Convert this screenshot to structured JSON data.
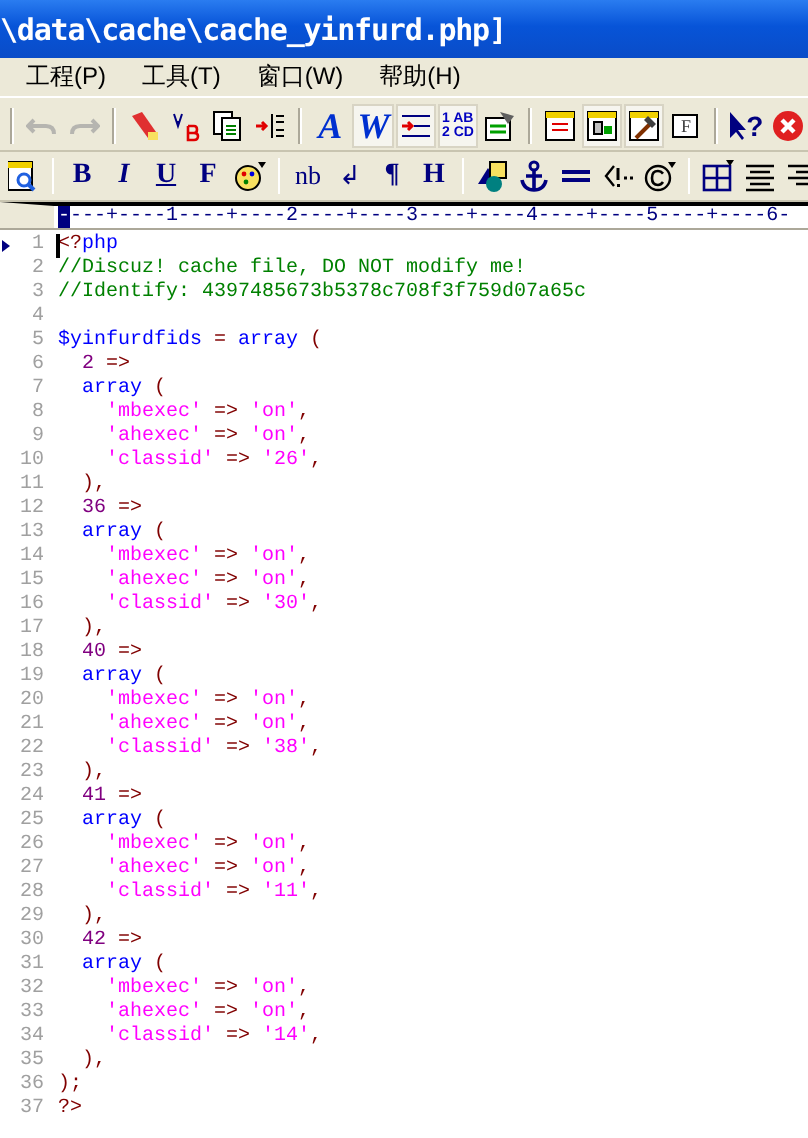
{
  "window": {
    "title": "\\data\\cache\\cache_yinfurd.php]"
  },
  "menu": [
    {
      "label": "工程(P)"
    },
    {
      "label": "工具(T)"
    },
    {
      "label": "窗口(W)"
    },
    {
      "label": "帮助(H)"
    }
  ],
  "toolbar": [
    {
      "kind": "sep"
    },
    {
      "kind": "undo",
      "disabled": true
    },
    {
      "kind": "redo",
      "disabled": true
    },
    {
      "kind": "sep"
    },
    {
      "kind": "flashlight",
      "pressed": false
    },
    {
      "kind": "replace",
      "pressed": false
    },
    {
      "kind": "copies",
      "pressed": false
    },
    {
      "kind": "indent-list",
      "pressed": false
    },
    {
      "kind": "sep"
    },
    {
      "kind": "letter",
      "label": "A",
      "pressed": false
    },
    {
      "kind": "letter",
      "label": "W",
      "pressed": true
    },
    {
      "kind": "indent",
      "pressed": true
    },
    {
      "kind": "numbered",
      "label": "1 AB",
      "label2": "2 CD",
      "pressed": true
    },
    {
      "kind": "certificate",
      "pressed": false
    },
    {
      "kind": "sep"
    },
    {
      "kind": "window-list",
      "pressed": false
    },
    {
      "kind": "window-panel",
      "pressed": true
    },
    {
      "kind": "hammer",
      "pressed": true
    },
    {
      "kind": "window-f",
      "label": "F",
      "pressed": false
    },
    {
      "kind": "sep"
    },
    {
      "kind": "help",
      "label": "?",
      "pressed": false
    },
    {
      "kind": "close",
      "pressed": false
    }
  ],
  "format_toolbar": [
    {
      "kind": "preview"
    },
    {
      "kind": "sep"
    },
    {
      "kind": "bold",
      "label": "B"
    },
    {
      "kind": "italic",
      "label": "I"
    },
    {
      "kind": "underline",
      "label": "U"
    },
    {
      "kind": "bold",
      "label": "F"
    },
    {
      "kind": "palette"
    },
    {
      "kind": "sep"
    },
    {
      "kind": "plain",
      "label": "nb"
    },
    {
      "kind": "plain",
      "label": "↲"
    },
    {
      "kind": "bold",
      "label": "¶"
    },
    {
      "kind": "bold",
      "label": "H"
    },
    {
      "kind": "sep"
    },
    {
      "kind": "shapes"
    },
    {
      "kind": "anchor"
    },
    {
      "kind": "rule"
    },
    {
      "kind": "comment"
    },
    {
      "kind": "copyright"
    },
    {
      "kind": "sep"
    },
    {
      "kind": "table"
    },
    {
      "kind": "align-center"
    },
    {
      "kind": "align-right"
    }
  ],
  "ruler": {
    "text": "----+----1----+----2----+----3----+----4----+----5----+----6-"
  },
  "editor": {
    "lines": [
      {
        "number": "1",
        "marked": true,
        "tokens": [
          {
            "kind": "punct",
            "text": "<?"
          },
          {
            "kind": "keyword",
            "text": "php"
          }
        ]
      },
      {
        "number": "2",
        "marked": false,
        "tokens": [
          {
            "kind": "comment",
            "text": "//Discuz! cache file, DO NOT modify me!"
          }
        ]
      },
      {
        "number": "3",
        "marked": false,
        "tokens": [
          {
            "kind": "comment",
            "text": "//Identify: 4397485673b5378c708f3f759d07a65c"
          }
        ]
      },
      {
        "number": "4",
        "marked": false
      },
      {
        "number": "5",
        "marked": false,
        "tokens": [
          {
            "kind": "variable",
            "text": "$yinfurdfids"
          },
          {
            "kind": "punct",
            "text": " = "
          },
          {
            "kind": "keyword",
            "text": "array"
          },
          {
            "kind": "punct",
            "text": " ("
          }
        ]
      },
      {
        "number": "6",
        "marked": false,
        "tokens": [
          {
            "kind": "number",
            "text": "  2"
          },
          {
            "kind": "punct",
            "text": " =>"
          }
        ]
      },
      {
        "number": "7",
        "marked": false,
        "tokens": [
          {
            "kind": "keyword",
            "text": "  array"
          },
          {
            "kind": "punct",
            "text": " ("
          }
        ]
      },
      {
        "number": "8",
        "marked": false,
        "tokens": [
          {
            "kind": "string",
            "text": "    'mbexec'"
          },
          {
            "kind": "punct",
            "text": " => "
          },
          {
            "kind": "string",
            "text": "'on'"
          },
          {
            "kind": "punct",
            "text": ","
          }
        ]
      },
      {
        "number": "9",
        "marked": false,
        "tokens": [
          {
            "kind": "string",
            "text": "    'ahexec'"
          },
          {
            "kind": "punct",
            "text": " => "
          },
          {
            "kind": "string",
            "text": "'on'"
          },
          {
            "kind": "punct",
            "text": ","
          }
        ]
      },
      {
        "number": "10",
        "marked": false,
        "tokens": [
          {
            "kind": "string",
            "text": "    'classid'"
          },
          {
            "kind": "punct",
            "text": " => "
          },
          {
            "kind": "string",
            "text": "'26'"
          },
          {
            "kind": "punct",
            "text": ","
          }
        ]
      },
      {
        "number": "11",
        "marked": false,
        "tokens": [
          {
            "kind": "punct",
            "text": "  ),"
          }
        ]
      },
      {
        "number": "12",
        "marked": false,
        "tokens": [
          {
            "kind": "number",
            "text": "  36"
          },
          {
            "kind": "punct",
            "text": " =>"
          }
        ]
      },
      {
        "number": "13",
        "marked": false,
        "tokens": [
          {
            "kind": "keyword",
            "text": "  array"
          },
          {
            "kind": "punct",
            "text": " ("
          }
        ]
      },
      {
        "number": "14",
        "marked": false,
        "tokens": [
          {
            "kind": "string",
            "text": "    'mbexec'"
          },
          {
            "kind": "punct",
            "text": " => "
          },
          {
            "kind": "string",
            "text": "'on'"
          },
          {
            "kind": "punct",
            "text": ","
          }
        ]
      },
      {
        "number": "15",
        "marked": false,
        "tokens": [
          {
            "kind": "string",
            "text": "    'ahexec'"
          },
          {
            "kind": "punct",
            "text": " => "
          },
          {
            "kind": "string",
            "text": "'on'"
          },
          {
            "kind": "punct",
            "text": ","
          }
        ]
      },
      {
        "number": "16",
        "marked": false,
        "tokens": [
          {
            "kind": "string",
            "text": "    'classid'"
          },
          {
            "kind": "punct",
            "text": " => "
          },
          {
            "kind": "string",
            "text": "'30'"
          },
          {
            "kind": "punct",
            "text": ","
          }
        ]
      },
      {
        "number": "17",
        "marked": false,
        "tokens": [
          {
            "kind": "punct",
            "text": "  ),"
          }
        ]
      },
      {
        "number": "18",
        "marked": false,
        "tokens": [
          {
            "kind": "number",
            "text": "  40"
          },
          {
            "kind": "punct",
            "text": " =>"
          }
        ]
      },
      {
        "number": "19",
        "marked": false,
        "tokens": [
          {
            "kind": "keyword",
            "text": "  array"
          },
          {
            "kind": "punct",
            "text": " ("
          }
        ]
      },
      {
        "number": "20",
        "marked": false,
        "tokens": [
          {
            "kind": "string",
            "text": "    'mbexec'"
          },
          {
            "kind": "punct",
            "text": " => "
          },
          {
            "kind": "string",
            "text": "'on'"
          },
          {
            "kind": "punct",
            "text": ","
          }
        ]
      },
      {
        "number": "21",
        "marked": false,
        "tokens": [
          {
            "kind": "string",
            "text": "    'ahexec'"
          },
          {
            "kind": "punct",
            "text": " => "
          },
          {
            "kind": "string",
            "text": "'on'"
          },
          {
            "kind": "punct",
            "text": ","
          }
        ]
      },
      {
        "number": "22",
        "marked": false,
        "tokens": [
          {
            "kind": "string",
            "text": "    'classid'"
          },
          {
            "kind": "punct",
            "text": " => "
          },
          {
            "kind": "string",
            "text": "'38'"
          },
          {
            "kind": "punct",
            "text": ","
          }
        ]
      },
      {
        "number": "23",
        "marked": false,
        "tokens": [
          {
            "kind": "punct",
            "text": "  ),"
          }
        ]
      },
      {
        "number": "24",
        "marked": false,
        "tokens": [
          {
            "kind": "number",
            "text": "  41"
          },
          {
            "kind": "punct",
            "text": " =>"
          }
        ]
      },
      {
        "number": "25",
        "marked": false,
        "tokens": [
          {
            "kind": "keyword",
            "text": "  array"
          },
          {
            "kind": "punct",
            "text": " ("
          }
        ]
      },
      {
        "number": "26",
        "marked": false,
        "tokens": [
          {
            "kind": "string",
            "text": "    'mbexec'"
          },
          {
            "kind": "punct",
            "text": " => "
          },
          {
            "kind": "string",
            "text": "'on'"
          },
          {
            "kind": "punct",
            "text": ","
          }
        ]
      },
      {
        "number": "27",
        "marked": false,
        "tokens": [
          {
            "kind": "string",
            "text": "    'ahexec'"
          },
          {
            "kind": "punct",
            "text": " => "
          },
          {
            "kind": "string",
            "text": "'on'"
          },
          {
            "kind": "punct",
            "text": ","
          }
        ]
      },
      {
        "number": "28",
        "marked": false,
        "tokens": [
          {
            "kind": "string",
            "text": "    'classid'"
          },
          {
            "kind": "punct",
            "text": " => "
          },
          {
            "kind": "string",
            "text": "'11'"
          },
          {
            "kind": "punct",
            "text": ","
          }
        ]
      },
      {
        "number": "29",
        "marked": false,
        "tokens": [
          {
            "kind": "punct",
            "text": "  ),"
          }
        ]
      },
      {
        "number": "30",
        "marked": false,
        "tokens": [
          {
            "kind": "number",
            "text": "  42"
          },
          {
            "kind": "punct",
            "text": " =>"
          }
        ]
      },
      {
        "number": "31",
        "marked": false,
        "tokens": [
          {
            "kind": "keyword",
            "text": "  array"
          },
          {
            "kind": "punct",
            "text": " ("
          }
        ]
      },
      {
        "number": "32",
        "marked": false,
        "tokens": [
          {
            "kind": "string",
            "text": "    'mbexec'"
          },
          {
            "kind": "punct",
            "text": " => "
          },
          {
            "kind": "string",
            "text": "'on'"
          },
          {
            "kind": "punct",
            "text": ","
          }
        ]
      },
      {
        "number": "33",
        "marked": false,
        "tokens": [
          {
            "kind": "string",
            "text": "    'ahexec'"
          },
          {
            "kind": "punct",
            "text": " => "
          },
          {
            "kind": "string",
            "text": "'on'"
          },
          {
            "kind": "punct",
            "text": ","
          }
        ]
      },
      {
        "number": "34",
        "marked": false,
        "tokens": [
          {
            "kind": "string",
            "text": "    'classid'"
          },
          {
            "kind": "punct",
            "text": " => "
          },
          {
            "kind": "string",
            "text": "'14'"
          },
          {
            "kind": "punct",
            "text": ","
          }
        ]
      },
      {
        "number": "35",
        "marked": false,
        "tokens": [
          {
            "kind": "punct",
            "text": "  ),"
          }
        ]
      },
      {
        "number": "36",
        "marked": false,
        "tokens": [
          {
            "kind": "punct",
            "text": ");"
          }
        ]
      },
      {
        "number": "37",
        "marked": false,
        "tokens": [
          {
            "kind": "punct",
            "text": "?>"
          }
        ]
      }
    ]
  }
}
